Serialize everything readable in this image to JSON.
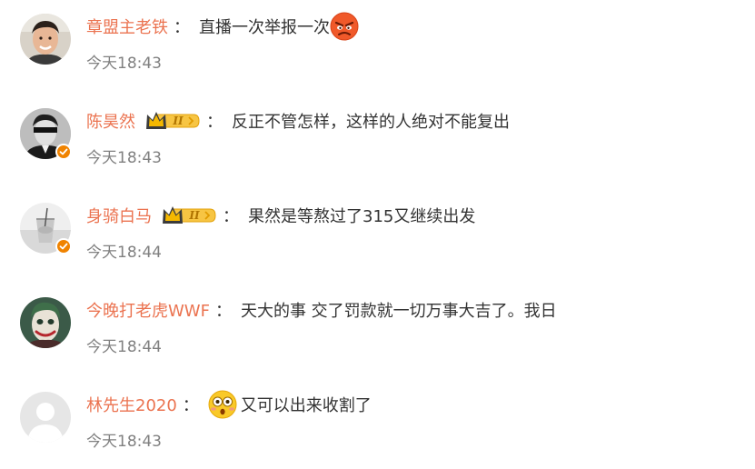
{
  "comments": [
    {
      "username": "章盟主老铁",
      "colon": "：",
      "text": "直播一次举报一次",
      "time": "今天18:43",
      "verified": false,
      "vip_level": "",
      "emoji_before": "",
      "emoji_after": "angry-face-emoji"
    },
    {
      "username": "陈昊然",
      "colon": "：",
      "text": "反正不管怎样，这样的人绝对不能复出",
      "time": "今天18:43",
      "verified": true,
      "vip_level": "II",
      "emoji_before": "",
      "emoji_after": ""
    },
    {
      "username": "身骑白马",
      "colon": "：",
      "text": "果然是等熬过了315又继续出发",
      "time": "今天18:44",
      "verified": true,
      "vip_level": "II",
      "emoji_before": "",
      "emoji_after": ""
    },
    {
      "username": "今晚打老虎WWF",
      "colon": "：",
      "text": "天大的事 交了罚款就一切万事大吉了。我日",
      "time": "今天18:44",
      "verified": false,
      "vip_level": "",
      "emoji_before": "",
      "emoji_after": ""
    },
    {
      "username": "林先生2020",
      "colon": "：",
      "text": "又可以出来收割了",
      "time": "今天18:43",
      "verified": false,
      "vip_level": "",
      "emoji_before": "shocked-face-emoji",
      "emoji_after": ""
    }
  ],
  "colors": {
    "username": "#eb7350",
    "text": "#333333",
    "time": "#808080",
    "verified_badge": "#f08300",
    "vip_gold": "#f2b600"
  }
}
